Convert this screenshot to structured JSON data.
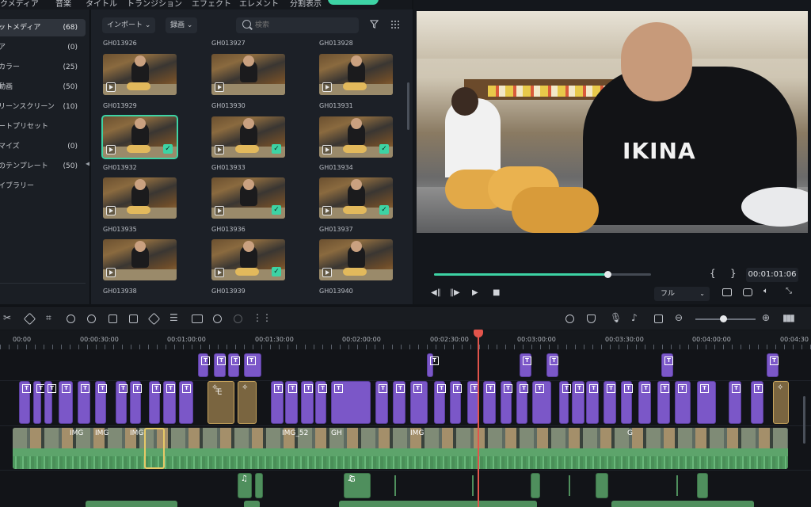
{
  "menu": {
    "tabs": [
      "クメディア",
      "音楽",
      "タイトル",
      "トランジション",
      "エフェクト",
      "エレメント",
      "分割表示"
    ]
  },
  "sidebar": {
    "items": [
      {
        "label": "ットメディア",
        "count": "(68)",
        "active": true
      },
      {
        "label": "ア",
        "count": "(0)"
      },
      {
        "label": "カラー",
        "count": "(25)"
      },
      {
        "label": "動画",
        "count": "(50)"
      },
      {
        "label": "リーンスクリーン",
        "count": "(10)"
      },
      {
        "label": "ートプリセット",
        "count": ""
      },
      {
        "label": "マイズ",
        "count": "(0)"
      },
      {
        "label": "のテンプレート",
        "count": "(50)"
      },
      {
        "label": "イブラリー",
        "count": ""
      }
    ]
  },
  "media": {
    "import_label": "インポート",
    "record_label": "録画",
    "search_placeholder": "検索",
    "top_row": [
      "GH013926",
      "GH013927",
      "GH013928"
    ],
    "rows": [
      {
        "names": [
          "GH013929",
          "GH013930",
          "GH013931"
        ],
        "checked": [
          false,
          false,
          false
        ]
      },
      {
        "names": [
          "GH013932",
          "GH013933",
          "GH013934"
        ],
        "checked": [
          true,
          true,
          true
        ]
      },
      {
        "names": [
          "GH013935",
          "GH013936",
          "GH013937"
        ],
        "checked": [
          false,
          true,
          true
        ]
      },
      {
        "names": [
          "GH013938",
          "GH013939",
          "GH013940"
        ],
        "checked": [
          false,
          true,
          false
        ]
      }
    ]
  },
  "preview": {
    "shirt_text": "IKINA",
    "progress": 0.8,
    "open_brace": "{",
    "close_brace": "}",
    "timecode": "00:01:01:06",
    "quality": "フル"
  },
  "timeline": {
    "ruler_labels": [
      "00:00",
      "00:00:30:00",
      "00:01:00:00",
      "00:01:30:00",
      "00:02:00:00",
      "00:02:30:00",
      "00:03:00:00",
      "00:03:30:00",
      "00:04:00:00",
      "00:04:30"
    ],
    "video_labels": [
      "IMG",
      "IMG",
      "IMG",
      "IMG_52",
      "GH",
      "IMG",
      "G"
    ],
    "fx_labels": [
      "モ"
    ],
    "audio_label": "G"
  },
  "colors": {
    "accent": "#3dd3a4",
    "title_clip": "#7b57c8",
    "video_clip": "#5da46b",
    "playhead": "#e2544b"
  }
}
